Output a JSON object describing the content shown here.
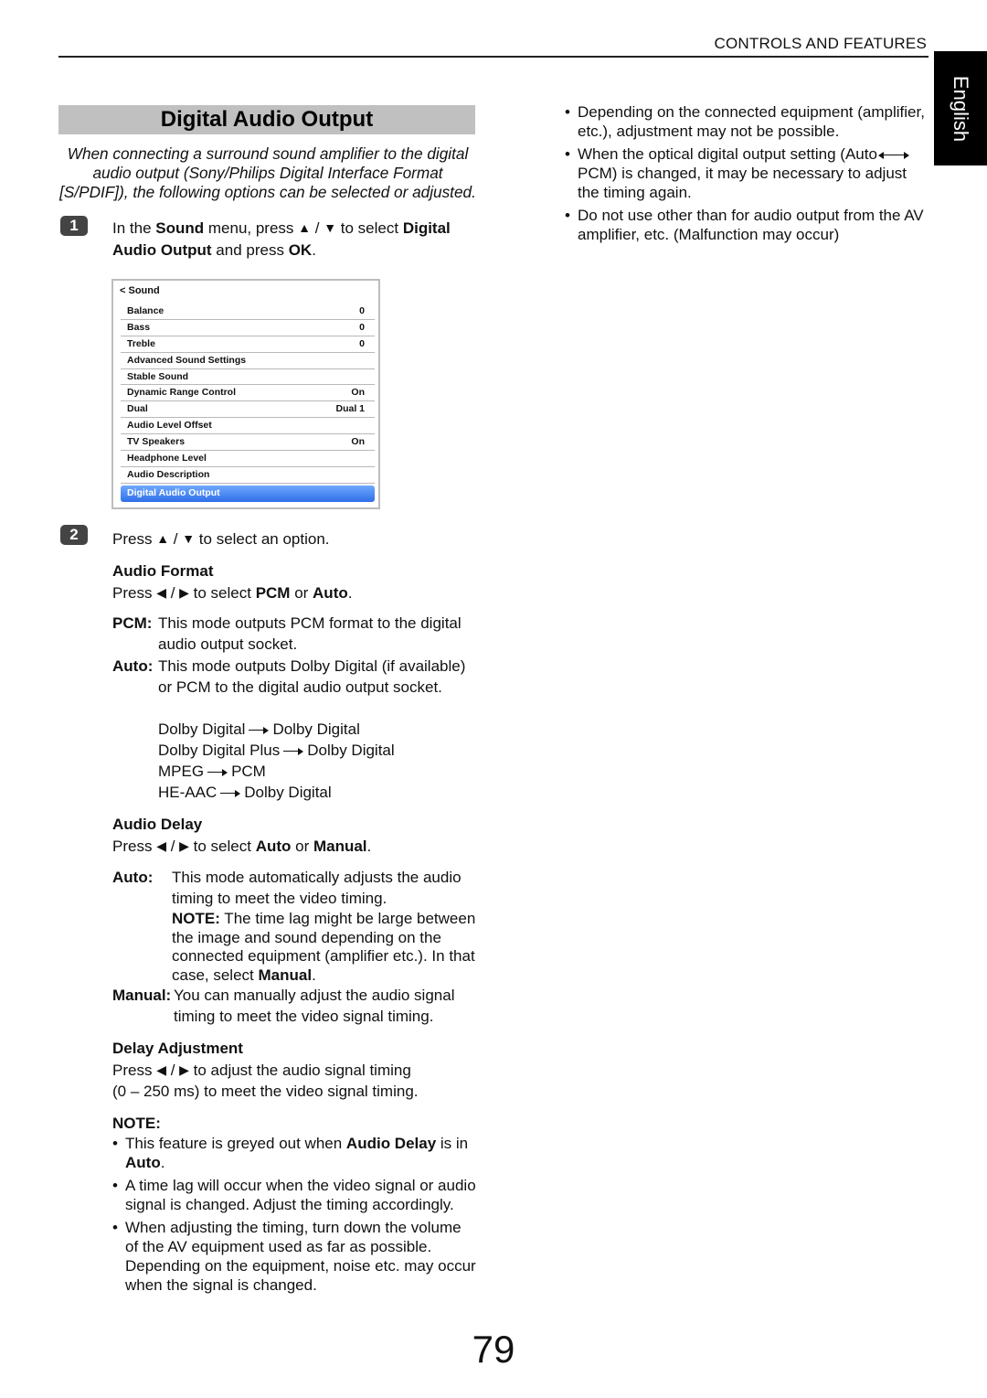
{
  "header": {
    "section": "CONTROLS AND FEATURES",
    "language_tab": "English"
  },
  "title": "Digital Audio Output",
  "intro": "When connecting a surround sound amplifier to the digital audio output (Sony/Philips Digital Interface Format [S/PDIF]), the following options can be selected or adjusted.",
  "step1": {
    "badge": "1",
    "t1": "In the ",
    "b1": "Sound",
    "t2": " menu, press ",
    "up": "▲",
    "slash": " / ",
    "down": "▼",
    "t3": " to select ",
    "b2": "Digital Audio Output",
    "t4": " and press ",
    "b3": "OK",
    "t5": "."
  },
  "sound_menu": {
    "header": "< Sound",
    "rows": [
      {
        "label": "Balance",
        "value": "0"
      },
      {
        "label": "Bass",
        "value": "0"
      },
      {
        "label": "Treble",
        "value": "0"
      },
      {
        "label": "Advanced Sound Settings",
        "value": ""
      },
      {
        "label": "Stable Sound",
        "value": ""
      },
      {
        "label": "Dynamic Range Control",
        "value": "On"
      },
      {
        "label": "Dual",
        "value": "Dual 1"
      },
      {
        "label": "Audio Level Offset",
        "value": ""
      },
      {
        "label": "TV Speakers",
        "value": "On"
      },
      {
        "label": "Headphone Level",
        "value": ""
      },
      {
        "label": "Audio Description",
        "value": ""
      },
      {
        "label": "Digital Audio Output",
        "value": "",
        "selected": true
      }
    ],
    "selected_color": "#3b7bf0"
  },
  "step2": {
    "badge": "2",
    "t1": "Press ",
    "up": "▲",
    "slash": " / ",
    "down": "▼",
    "t2": " to select an option."
  },
  "audio_format": {
    "heading": "Audio Format",
    "press": "Press ",
    "left": "◀",
    "slash": " / ",
    "right": "▶",
    "t1": " to select ",
    "b1": "PCM",
    "t2": " or ",
    "b2": "Auto",
    "t3": ".",
    "pcm_label": "PCM:",
    "pcm_desc": "This mode outputs PCM format to the digital audio output socket.",
    "auto_label": "Auto:",
    "auto_desc": "This mode outputs Dolby Digital (if available) or PCM to the digital audio output socket.",
    "conversions": [
      {
        "from": "Dolby Digital",
        "to": "Dolby Digital"
      },
      {
        "from": "Dolby Digital Plus",
        "to": "Dolby Digital"
      },
      {
        "from": "MPEG",
        "to": "PCM"
      },
      {
        "from": "HE-AAC",
        "to": "Dolby Digital"
      }
    ]
  },
  "audio_delay": {
    "heading": "Audio Delay",
    "press": "Press ",
    "left": "◀",
    "slash": " / ",
    "right": "▶",
    "t1": " to select ",
    "b1": "Auto",
    "t2": " or ",
    "b2": "Manual",
    "t3": ".",
    "auto_label": "Auto:",
    "auto_desc": "This mode automatically adjusts the audio timing to meet the video timing.",
    "note_label": "NOTE:",
    "note_text": " The time lag might be large between the image and sound depending on the connected equipment (amplifier etc.). In that case, select ",
    "note_bold": "Manual",
    "note_end": ".",
    "manual_label": "Manual:",
    "manual_desc": "You can manually adjust the audio signal timing to meet the video signal timing."
  },
  "delay_adjustment": {
    "heading": "Delay Adjustment",
    "press": "Press ",
    "left": "◀",
    "slash": " / ",
    "right": "▶",
    "t1": " to adjust the audio signal timing",
    "line2": "(0 – 250 ms) to meet the video signal timing."
  },
  "note": {
    "heading": "NOTE:",
    "b1_t1": "This feature is greyed out when ",
    "b1_b1": "Audio Delay",
    "b1_t2": " is in ",
    "b1_b2": "Auto",
    "b1_t3": ".",
    "b2": "A time lag will occur when the video signal or audio signal is changed. Adjust the timing accordingly.",
    "b3": "When adjusting the timing, turn down the volume of the AV equipment used as far as possible. Depending on the equipment, noise etc. may occur when the signal is changed."
  },
  "right_column": {
    "bullet1": "Depending on the connected equipment (amplifier, etc.), adjustment may not be possible.",
    "bullet2_t1": "When the optical digital output setting (Auto",
    "bullet2_t2": "PCM) is changed, it may be necessary to adjust the timing again.",
    "bullet3": "Do not use other than for audio output from the AV amplifier, etc. (Malfunction may occur)"
  },
  "page_number": "79"
}
